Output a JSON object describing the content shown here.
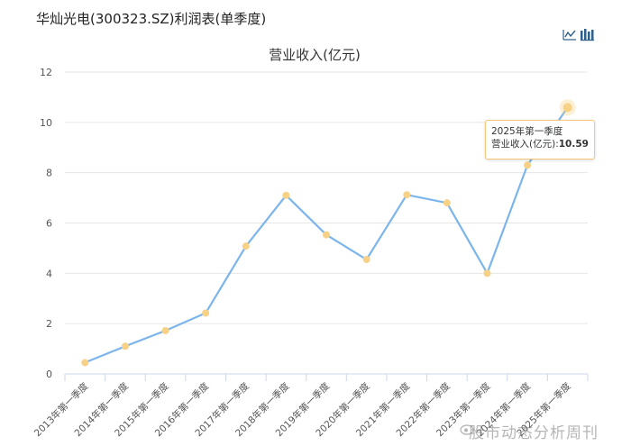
{
  "page": {
    "title": "华灿光电(300323.SZ)利润表(单季度)"
  },
  "toolbar": {
    "icons": [
      "line-chart-icon",
      "bar-chart-icon"
    ]
  },
  "chart_data": {
    "type": "line",
    "title": "营业收入(亿元)",
    "categories": [
      "2013年第一季度",
      "2014年第一季度",
      "2015年第一季度",
      "2016年第一季度",
      "2017年第一季度",
      "2018年第一季度",
      "2019年第一季度",
      "2020年第一季度",
      "2021年第一季度",
      "2022年第一季度",
      "2023年第一季度",
      "2024年第一季度",
      "2025年第一季度"
    ],
    "series": [
      {
        "values": [
          0.45,
          1.1,
          1.72,
          2.42,
          5.08,
          7.1,
          5.53,
          4.55,
          7.12,
          6.8,
          4.0,
          8.3,
          10.59
        ],
        "color": "#7cb5ec"
      }
    ],
    "ylim": [
      0,
      12
    ],
    "yticks": [
      0,
      2,
      4,
      6,
      8,
      10,
      12
    ],
    "grid": true,
    "marker_color": "#f7d185",
    "highlight_index": 12
  },
  "tooltip": {
    "line1": "2025年第一季度",
    "label": "营业收入(亿元):",
    "value": "10.59"
  },
  "watermark": {
    "text": "股市动态分析周刊"
  }
}
